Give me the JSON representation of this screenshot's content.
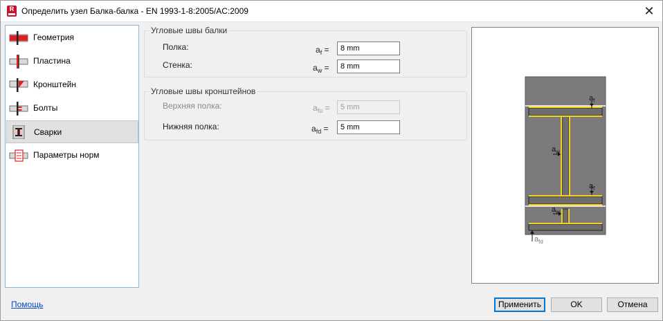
{
  "window": {
    "title": "Определить узел Балка-балка - EN 1993-1-8:2005/AC:2009"
  },
  "nav": {
    "items": [
      {
        "label": "Геометрия",
        "icon": "geometry-icon",
        "selected": false
      },
      {
        "label": "Пластина",
        "icon": "plate-icon",
        "selected": false
      },
      {
        "label": "Кронштейн",
        "icon": "bracket-icon",
        "selected": false
      },
      {
        "label": "Болты",
        "icon": "bolts-icon",
        "selected": false
      },
      {
        "label": "Сварки",
        "icon": "welds-icon",
        "selected": true
      },
      {
        "label": "Параметры норм",
        "icon": "code-params-icon",
        "selected": false
      }
    ]
  },
  "beam_welds": {
    "title": "Угловые швы балки",
    "flange_label": "Полка:",
    "flange_sym": "a",
    "flange_sub": "f",
    "flange_value": "8 mm",
    "web_label": "Стенка:",
    "web_sym": "a",
    "web_sub": "w",
    "web_value": "8 mm"
  },
  "bracket_welds": {
    "title": "Угловые швы кронштейнов",
    "top_label": "Верхняя полка:",
    "top_sym": "a",
    "top_sub": "fu",
    "top_value": "5 mm",
    "bottom_label": "Нижняя полка:",
    "bottom_sym": "a",
    "bottom_sub": "fd",
    "bottom_value": "5 mm"
  },
  "preview": {
    "labels": {
      "af_top": "a",
      "af_top_sub": "f",
      "aw_mid": "a",
      "aw_mid_sub": "w",
      "af_low": "a",
      "af_low_sub": "f",
      "aw_bracket": "a",
      "aw_bracket_sub": "w",
      "afd": "a",
      "afd_sub": "fd"
    },
    "colors": {
      "steel": "#7a7a7a",
      "weld": "#f2d21b"
    }
  },
  "footer": {
    "help": "Помощь",
    "apply": "Применить",
    "ok": "OK",
    "cancel": "Отмена"
  }
}
